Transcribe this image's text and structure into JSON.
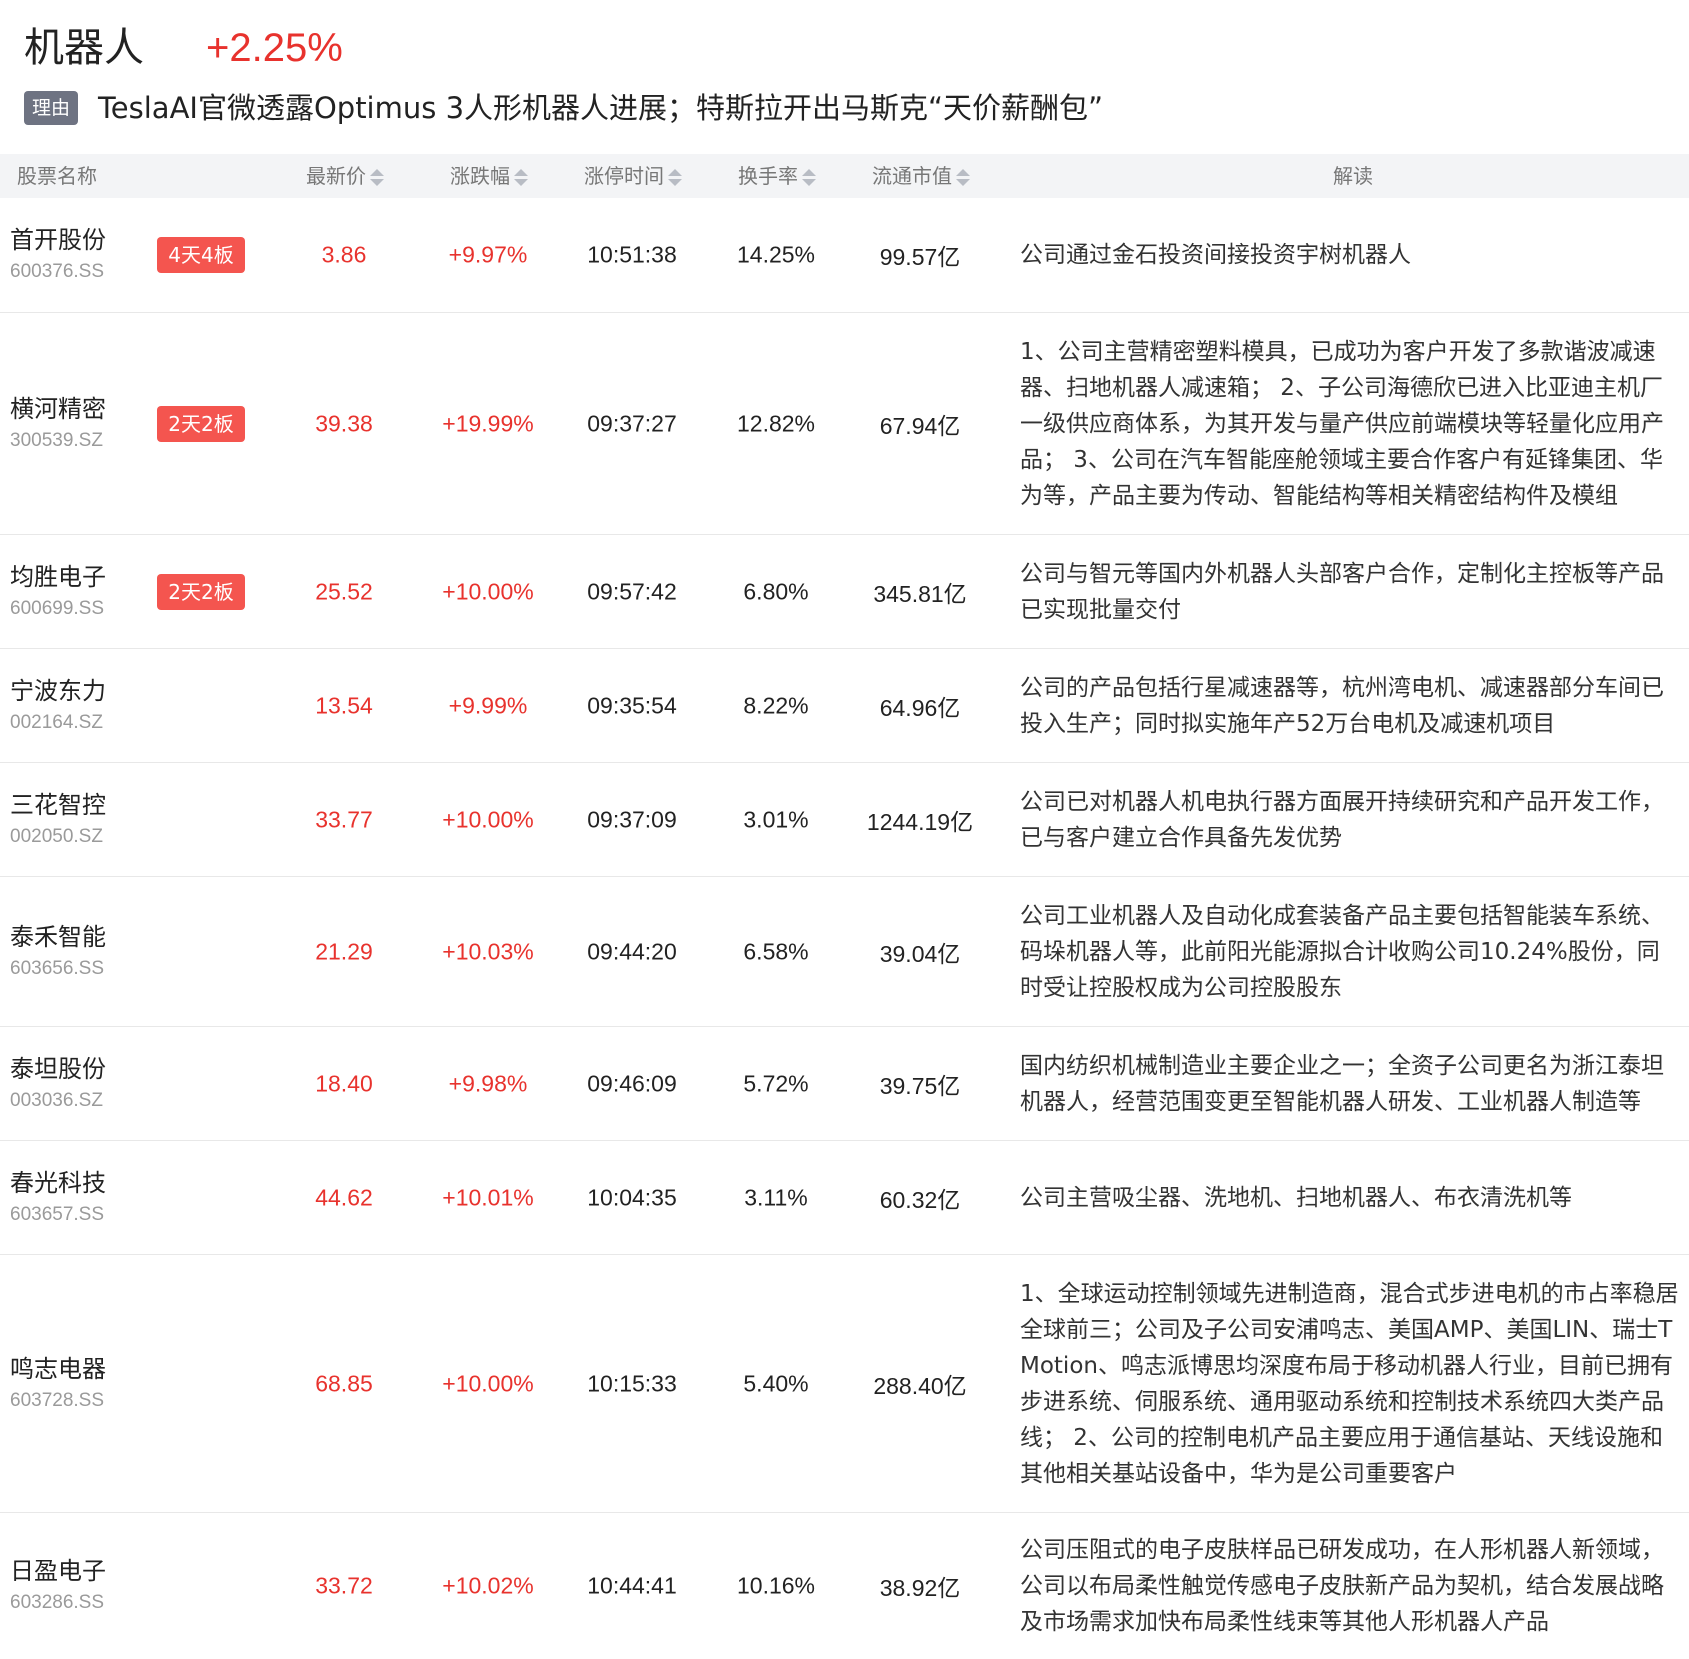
{
  "header": {
    "sector_name": "机器人",
    "sector_change": "+2.25%",
    "reason_label": "理由",
    "reason_text": "TeslaAI官微透露Optimus 3人形机器人进展；特斯拉开出马斯克“天价薪酬包”"
  },
  "colors": {
    "up": "#e8322d",
    "tag_bg": "#f4554f",
    "reason_tag_bg": "#6e7382",
    "header_bg": "#f3f4f6"
  },
  "table": {
    "columns": [
      "股票名称",
      "最新价",
      "涨跌幅",
      "涨停时间",
      "换手率",
      "流通市值",
      "解读"
    ],
    "rows": [
      {
        "name": "首开股份",
        "code": "600376.SS",
        "tag": "4天4板",
        "price": "3.86",
        "change": "+9.97%",
        "limit_time": "10:51:38",
        "turnover": "14.25%",
        "float_cap": "99.57亿",
        "desc": "公司通过金石投资间接投资宇树机器人"
      },
      {
        "name": "横河精密",
        "code": "300539.SZ",
        "tag": "2天2板",
        "price": "39.38",
        "change": "+19.99%",
        "limit_time": "09:37:27",
        "turnover": "12.82%",
        "float_cap": "67.94亿",
        "desc": "1、公司主营精密塑料模具，已成功为客户开发了多款谐波减速器、扫地机器人减速箱； 2、子公司海德欣已进入比亚迪主机厂一级供应商体系，为其开发与量产供应前端模块等轻量化应用产品； 3、公司在汽车智能座舱领域主要合作客户有延锋集团、华为等，产品主要为传动、智能结构等相关精密结构件及模组"
      },
      {
        "name": "均胜电子",
        "code": "600699.SS",
        "tag": "2天2板",
        "price": "25.52",
        "change": "+10.00%",
        "limit_time": "09:57:42",
        "turnover": "6.80%",
        "float_cap": "345.81亿",
        "desc": "公司与智元等国内外机器人头部客户合作，定制化主控板等产品已实现批量交付"
      },
      {
        "name": "宁波东力",
        "code": "002164.SZ",
        "tag": "",
        "price": "13.54",
        "change": "+9.99%",
        "limit_time": "09:35:54",
        "turnover": "8.22%",
        "float_cap": "64.96亿",
        "desc": "公司的产品包括行星减速器等，杭州湾电机、减速器部分车间已投入生产；同时拟实施年产52万台电机及减速机项目"
      },
      {
        "name": "三花智控",
        "code": "002050.SZ",
        "tag": "",
        "price": "33.77",
        "change": "+10.00%",
        "limit_time": "09:37:09",
        "turnover": "3.01%",
        "float_cap": "1244.19亿",
        "desc": "公司已对机器人机电执行器方面展开持续研究和产品开发工作，已与客户建立合作具备先发优势"
      },
      {
        "name": "泰禾智能",
        "code": "603656.SS",
        "tag": "",
        "price": "21.29",
        "change": "+10.03%",
        "limit_time": "09:44:20",
        "turnover": "6.58%",
        "float_cap": "39.04亿",
        "desc": "公司工业机器人及自动化成套装备产品主要包括智能装车系统、码垛机器人等，此前阳光能源拟合计收购公司10.24%股份，同时受让控股权成为公司控股股东"
      },
      {
        "name": "泰坦股份",
        "code": "003036.SZ",
        "tag": "",
        "price": "18.40",
        "change": "+9.98%",
        "limit_time": "09:46:09",
        "turnover": "5.72%",
        "float_cap": "39.75亿",
        "desc": "国内纺织机械制造业主要企业之一；全资子公司更名为浙江泰坦机器人，经营范围变更至智能机器人研发、工业机器人制造等"
      },
      {
        "name": "春光科技",
        "code": "603657.SS",
        "tag": "",
        "price": "44.62",
        "change": "+10.01%",
        "limit_time": "10:04:35",
        "turnover": "3.11%",
        "float_cap": "60.32亿",
        "desc": "公司主营吸尘器、洗地机、扫地机器人、布衣清洗机等"
      },
      {
        "name": "鸣志电器",
        "code": "603728.SS",
        "tag": "",
        "price": "68.85",
        "change": "+10.00%",
        "limit_time": "10:15:33",
        "turnover": "5.40%",
        "float_cap": "288.40亿",
        "desc": "1、全球运动控制领域先进制造商，混合式步进电机的市占率稳居全球前三；公司及子公司安浦鸣志、美国AMP、美国LIN、瑞士T Motion、鸣志派博思均深度布局于移动机器人行业，目前已拥有步进系统、伺服系统、通用驱动系统和控制技术系统四大类产品线； 2、公司的控制电机产品主要应用于通信基站、天线设施和其他相关基站设备中，华为是公司重要客户"
      },
      {
        "name": "日盈电子",
        "code": "603286.SS",
        "tag": "",
        "price": "33.72",
        "change": "+10.02%",
        "limit_time": "10:44:41",
        "turnover": "10.16%",
        "float_cap": "38.92亿",
        "desc": "公司压阻式的电子皮肤样品已研发成功，在人形机器人新领域，公司以布局柔性触觉传感电子皮肤新产品为契机，结合发展战略及市场需求加快布局柔性线束等其他人形机器人产品"
      }
    ]
  }
}
